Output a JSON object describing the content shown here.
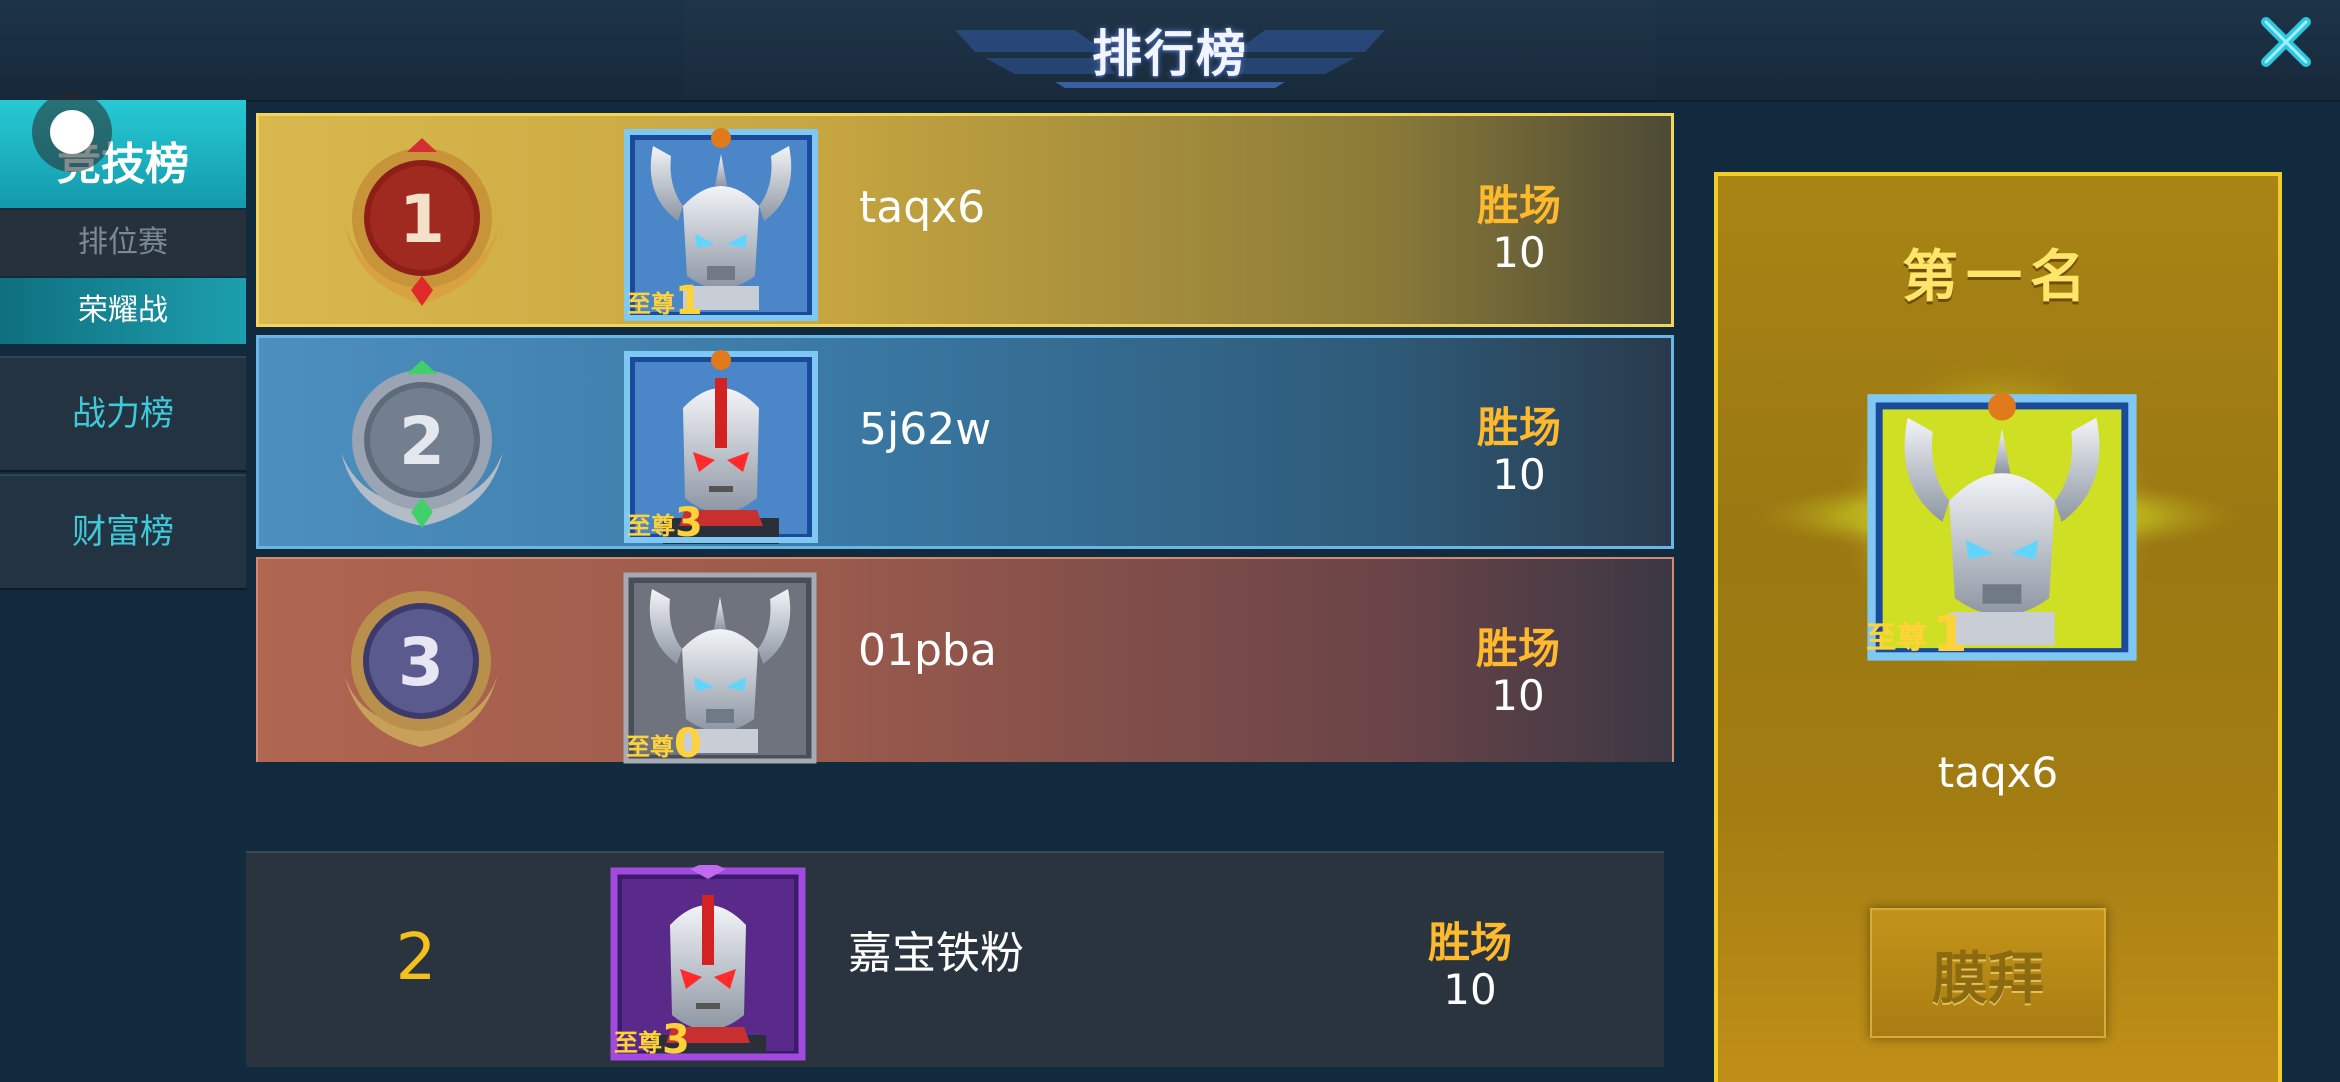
{
  "header": {
    "title": "排行榜"
  },
  "sidebar": {
    "main_tab": "竞技榜",
    "sub_items": [
      "排位赛",
      "荣耀战"
    ],
    "tabs": [
      "战力榜",
      "财富榜"
    ]
  },
  "ranking": {
    "rows": [
      {
        "rank": "1",
        "name": "taqx6",
        "badge_text": "至尊",
        "badge_level": "1",
        "win_label": "胜场",
        "wins": "10"
      },
      {
        "rank": "2",
        "name": "5j62w",
        "badge_text": "至尊",
        "badge_level": "3",
        "win_label": "胜场",
        "wins": "10"
      },
      {
        "rank": "3",
        "name": "01pba",
        "badge_text": "至尊",
        "badge_level": "0",
        "win_label": "胜场",
        "wins": "10"
      }
    ]
  },
  "my_rank": {
    "rank": "2",
    "name": "嘉宝铁粉",
    "badge_text": "至尊",
    "badge_level": "3",
    "win_label": "胜场",
    "wins": "10"
  },
  "top_panel": {
    "title": "第一名",
    "name": "taqx6",
    "badge_text": "至尊",
    "badge_level": "1",
    "worship_button": "膜拜"
  },
  "colors": {
    "accent_cyan": "#27c9d4",
    "gold": "#f3cc28",
    "win_label": "#ffb92c"
  }
}
